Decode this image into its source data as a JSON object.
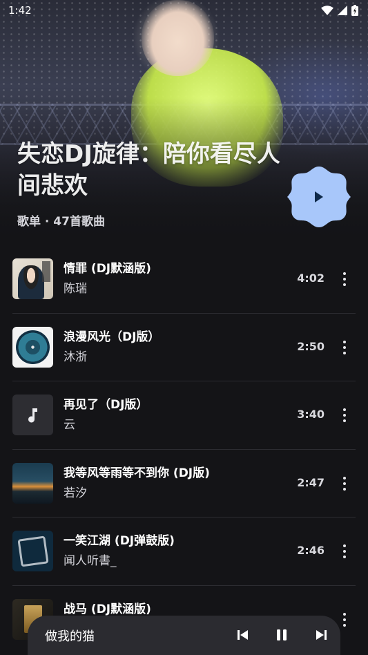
{
  "status_bar": {
    "time": "1:42"
  },
  "playlist": {
    "title": "失恋DJ旋律：陪你看尽人间悲欢",
    "meta": "歌单 · 47首歌曲"
  },
  "songs": [
    {
      "title": "情罪 (DJ默涵版)",
      "artist": "陈瑞",
      "duration": "4:02"
    },
    {
      "title": "浪漫风光（DJ版）",
      "artist": "沐浙",
      "duration": "2:50"
    },
    {
      "title": "再见了（DJ版）",
      "artist": "云",
      "duration": "3:40"
    },
    {
      "title": "我等风等雨等不到你 (DJ版)",
      "artist": "若汐",
      "duration": "2:47"
    },
    {
      "title": "一笑江湖 (DJ弹鼓版)",
      "artist": "闻人听書_",
      "duration": "2:46"
    },
    {
      "title": "战马 (DJ默涵版)",
      "artist": "",
      "duration": ""
    }
  ],
  "mini_player": {
    "title": "做我的猫"
  },
  "icons": {
    "play": "play-icon",
    "music_note": "music-note-icon",
    "more": "more-vert-icon",
    "prev": "skip-previous-icon",
    "pause": "pause-icon",
    "next": "skip-next-icon"
  },
  "colors": {
    "background": "#141417",
    "fab": "#a8c7fa",
    "mini_player": "#2b2b30"
  }
}
